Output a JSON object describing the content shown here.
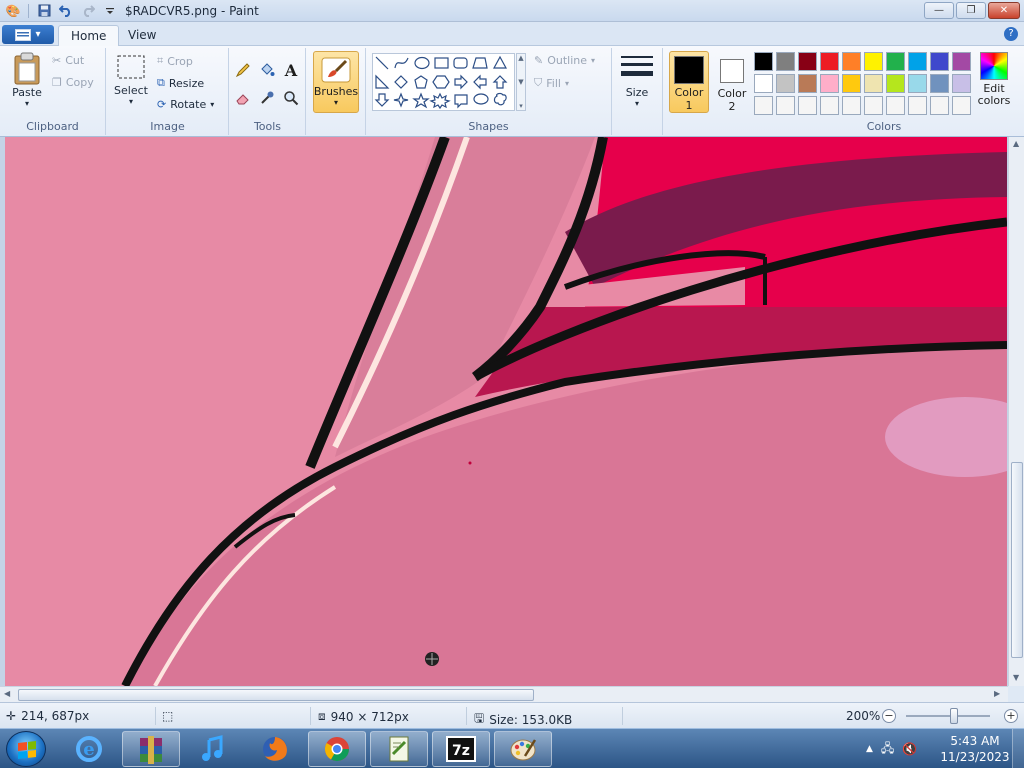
{
  "window": {
    "title": "$RADCVR5.png - Paint",
    "minimize": "—",
    "maximize": "❐",
    "close": "✕"
  },
  "tabs": [
    {
      "label": "Home"
    },
    {
      "label": "View"
    }
  ],
  "ribbon": {
    "clipboard": {
      "label": "Clipboard",
      "paste": "Paste",
      "cut": "Cut",
      "copy": "Copy"
    },
    "image": {
      "label": "Image",
      "select": "Select",
      "crop": "Crop",
      "resize": "Resize",
      "rotate": "Rotate"
    },
    "tools": {
      "label": "Tools"
    },
    "brushes": {
      "label": "Brushes"
    },
    "shapes": {
      "label": "Shapes",
      "outline": "Outline",
      "fill": "Fill"
    },
    "size": {
      "label": "Size"
    },
    "colors": {
      "label": "Colors",
      "color1": "Color 1",
      "color2": "Color 2",
      "edit_colors": "Edit colors",
      "color1_value": "#000000",
      "color2_value": "#ffffff",
      "palette": [
        "#000000",
        "#7f7f7f",
        "#880015",
        "#ed1c24",
        "#ff7f27",
        "#fff200",
        "#22b14c",
        "#00a2e8",
        "#3f48cc",
        "#a349a4",
        "#ffffff",
        "#c3c3c3",
        "#b97a57",
        "#ffaec9",
        "#ffc90e",
        "#efe4b0",
        "#b5e61d",
        "#99d9ea",
        "#7092be",
        "#c8bfe7",
        "#f5f5f5",
        "#f5f5f5",
        "#f5f5f5",
        "#f5f5f5",
        "#f5f5f5",
        "#f5f5f5",
        "#f5f5f5",
        "#f5f5f5",
        "#f5f5f5",
        "#f5f5f5"
      ]
    }
  },
  "status": {
    "cursor_pos": "214, 687px",
    "image_size": "940 × 712px",
    "file_size": "Size: 153.0KB",
    "zoom": "200%"
  },
  "taskbar": {
    "apps": [
      "winrar",
      "internet-explorer",
      "itunes",
      "firefox",
      "chrome",
      "notepad",
      "7zip",
      "paint"
    ],
    "time": "5:43 AM",
    "date": "11/23/2023"
  }
}
